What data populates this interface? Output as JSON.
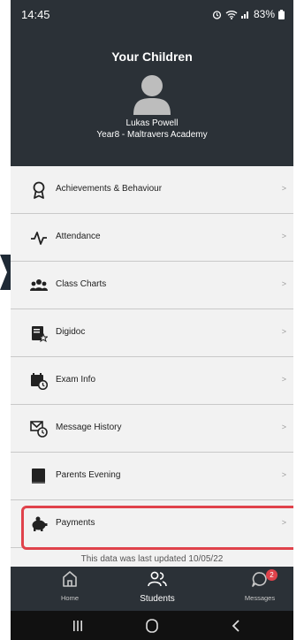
{
  "status_bar": {
    "time": "14:45",
    "battery": "83%"
  },
  "header": {
    "title": "Your Children",
    "child_name": "Lukas Powell",
    "child_school": "Year8 - Maltravers Academy"
  },
  "menu": {
    "chevron": ">",
    "items": [
      {
        "label": "Achievements & Behaviour",
        "icon": "award-ribbon-icon"
      },
      {
        "label": "Attendance",
        "icon": "pulse-icon"
      },
      {
        "label": "Class Charts",
        "icon": "group-icon"
      },
      {
        "label": "Digidoc",
        "icon": "document-star-icon"
      },
      {
        "label": "Exam Info",
        "icon": "calendar-clock-icon"
      },
      {
        "label": "Message History",
        "icon": "mail-clock-icon"
      },
      {
        "label": "Parents Evening",
        "icon": "book-icon"
      },
      {
        "label": "Payments",
        "icon": "piggy-bank-icon",
        "highlighted": true
      }
    ]
  },
  "updated_note": "This data was last updated 10/05/22",
  "bottom_nav": {
    "home": "Home",
    "students": "Students",
    "messages": "Messages",
    "messages_badge": "2",
    "active": "students"
  },
  "colors": {
    "header_bg": "#2b3137",
    "highlight_border": "#e0424b",
    "list_bg": "#f2f2f2"
  }
}
